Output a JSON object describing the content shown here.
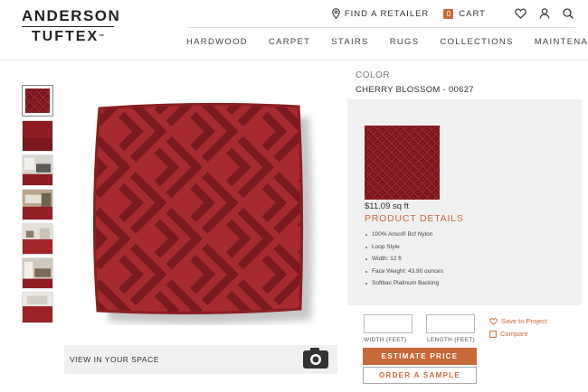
{
  "logo": {
    "line1": "ANDERSON",
    "line2": "TUFTEX",
    "tm": "™"
  },
  "utility": {
    "find_retailer": "FIND A RETAILER",
    "cart_label": "CART",
    "cart_count": "0",
    "icons": [
      "location-pin-icon",
      "cart-icon",
      "heart-icon",
      "user-icon",
      "search-icon"
    ]
  },
  "nav": [
    "HARDWOOD",
    "CARPET",
    "STAIRS",
    "RUGS",
    "COLLECTIONS",
    "MAINTENANCE"
  ],
  "gallery": {
    "thumbnails": [
      {
        "kind": "swatch",
        "active": true
      },
      {
        "kind": "carpet-closeup",
        "active": false
      },
      {
        "kind": "room-scene",
        "active": false
      },
      {
        "kind": "room-scene",
        "active": false
      },
      {
        "kind": "room-scene",
        "active": false
      },
      {
        "kind": "room-scene",
        "active": false
      },
      {
        "kind": "room-scene",
        "active": false
      }
    ],
    "view_in_space": "VIEW IN YOUR SPACE"
  },
  "product": {
    "color_label": "COLOR",
    "color_name": "CHERRY BLOSSOM - 00627",
    "price": "$11.09 sq ft",
    "details_title": "PRODUCT DETAILS",
    "specs": [
      "100% Anso® Bcf Nylon",
      "Loop Style",
      "Width: 12 ft",
      "Face Weight: 43.90 ounces",
      "Softbac Platinum Backing"
    ]
  },
  "estimator": {
    "width_value": "",
    "length_value": "",
    "width_label": "WIDTH (FEET)",
    "length_label": "LENGTH (FEET)",
    "save_label": "Save to Project",
    "compare_label": "Compare",
    "estimate_label": "ESTIMATE PRICE",
    "sample_label": "ORDER A SAMPLE"
  },
  "colors": {
    "accent": "#c8693a",
    "carpet_dark": "#7a1a20",
    "carpet_light": "#a82a2e"
  }
}
